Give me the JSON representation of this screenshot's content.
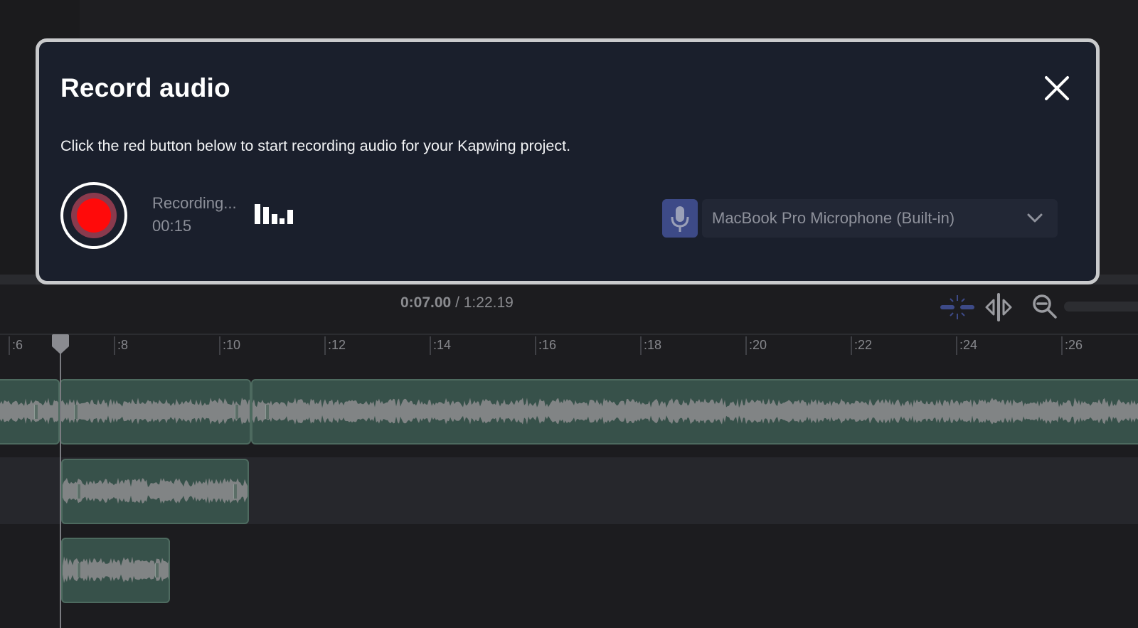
{
  "modal": {
    "title": "Record audio",
    "description": "Click the red button below to start recording audio for your Kapwing project.",
    "status": "Recording...",
    "elapsed": "00:15",
    "microphone": {
      "selected": "MacBook Pro Microphone (Built-in)"
    }
  },
  "timeline": {
    "current_time": "0:07.00",
    "separator": " / ",
    "total_time": "1:22.19",
    "ticks": [
      ":6",
      ":8",
      ":10",
      ":12",
      ":14",
      ":16",
      ":18",
      ":20",
      ":22",
      ":24",
      ":26"
    ]
  },
  "icons": {
    "close": "close-icon",
    "record": "record-icon",
    "level": "audio-level-icon",
    "mic": "microphone-icon",
    "dropdown": "chevron-down-icon",
    "snap": "snap-icon",
    "split": "split-icon",
    "zoom": "zoom-out-icon",
    "playhead": "playhead-icon"
  },
  "colors": {
    "record_red": "#ff0a0a",
    "clip_green": "#37514a",
    "mic_accent": "#3d4a87"
  }
}
